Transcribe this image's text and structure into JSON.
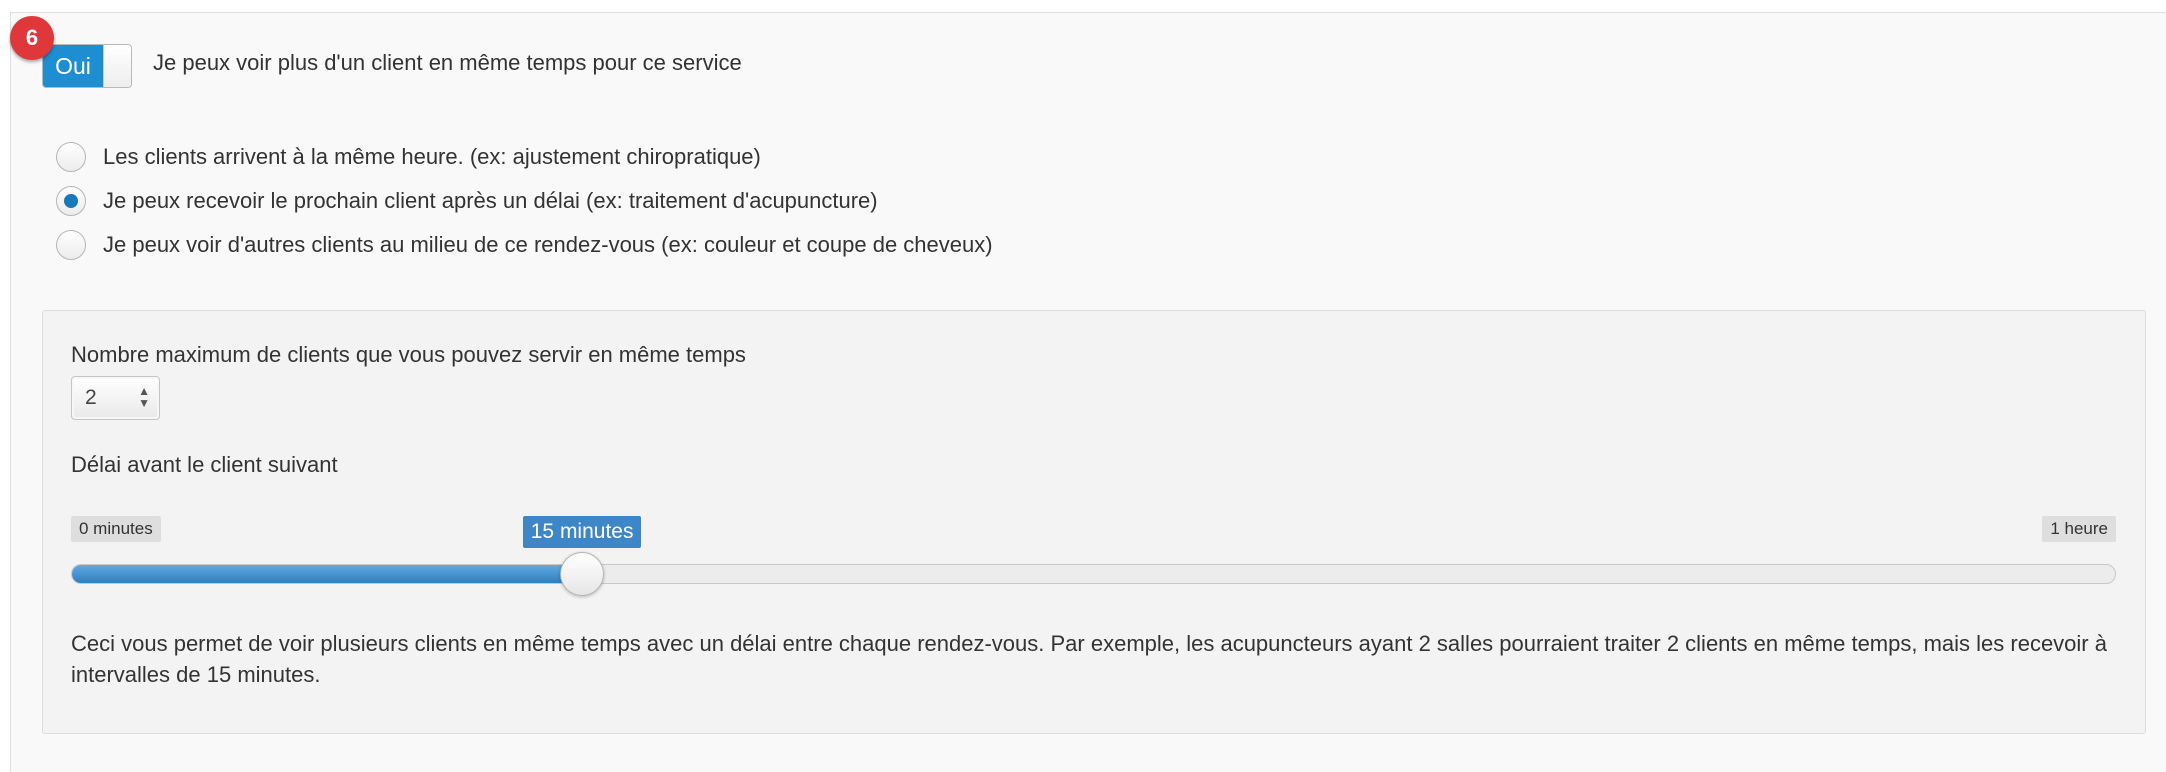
{
  "step_badge": "6",
  "multi_client_toggle": {
    "state_label": "Oui",
    "description": "Je peux voir plus d'un client en même temps pour ce service"
  },
  "scheduling_options": [
    {
      "label": "Les clients arrivent à la même heure. (ex: ajustement chiropratique)",
      "checked": false
    },
    {
      "label": "Je peux recevoir le prochain client après un délai (ex: traitement d'acupuncture)",
      "checked": true
    },
    {
      "label": "Je peux voir d'autres clients au milieu de ce rendez-vous (ex: couleur et coupe de cheveux)",
      "checked": false
    }
  ],
  "max_clients": {
    "label": "Nombre maximum de clients que vous pouvez servir en même temps",
    "value": "2"
  },
  "delay": {
    "label": "Délai avant le client suivant",
    "min_label": "0 minutes",
    "max_label": "1 heure",
    "current_label": "15 minutes",
    "value_minutes": 15,
    "max_minutes": 60
  },
  "description": "Ceci vous permet de voir plusieurs clients en même temps avec un délai entre chaque rendez-vous. Par exemple, les acupuncteurs ayant 2 salles pourraient traiter 2 clients en même temps, mais les recevoir à intervalles de 15 minutes.",
  "colors": {
    "accent": "#1d8ed1",
    "badge": "#e0383a",
    "slider_fill": "#2b7fc3"
  }
}
